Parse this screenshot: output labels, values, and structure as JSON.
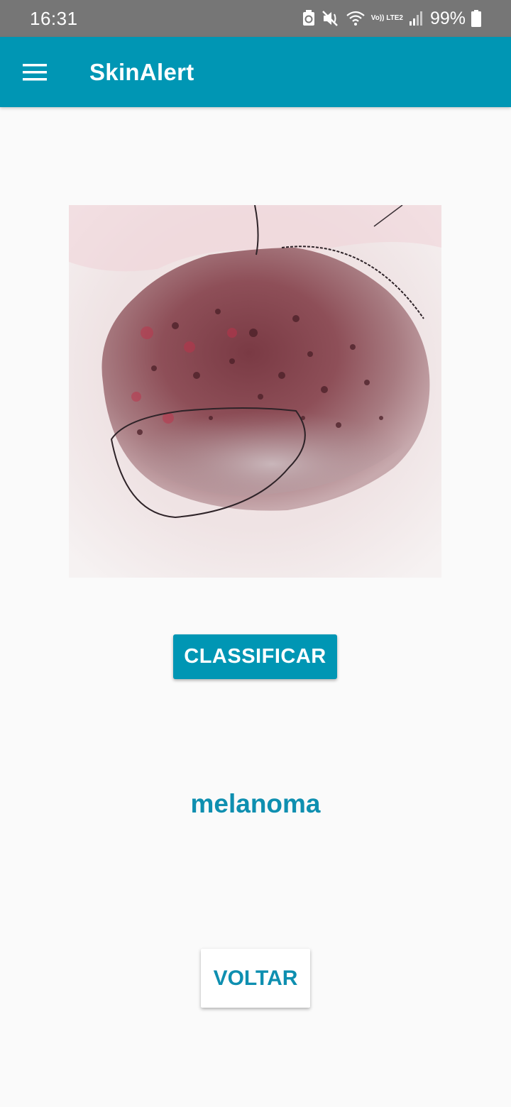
{
  "status_bar": {
    "time": "16:31",
    "network_label": "Vo)) LTE2",
    "battery_percent": "99%",
    "icons": [
      "recycle-icon",
      "mute-vibrate-icon",
      "wifi-icon",
      "volte-icon",
      "signal-icon",
      "battery-icon"
    ]
  },
  "app_bar": {
    "menu_icon": "hamburger-menu-icon",
    "title": "SkinAlert"
  },
  "main": {
    "image_subject": "dermoscopy lesion image",
    "classify_label": "CLASSIFICAR",
    "result": "melanoma",
    "back_label": "VOLTAR"
  },
  "colors": {
    "primary": "#0096b4",
    "status_bar": "#767676",
    "background": "#fafafa",
    "result_text": "#0e8fb0"
  }
}
